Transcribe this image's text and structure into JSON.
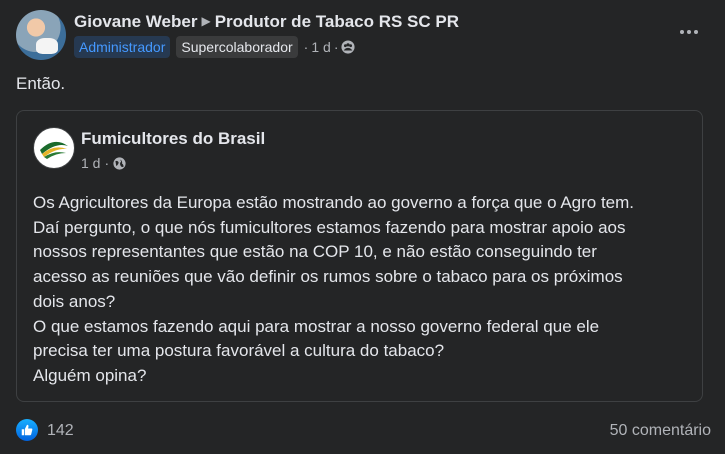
{
  "author": {
    "name": "Giovane Weber",
    "group": "Produtor de Tabaco RS SC PR",
    "badges": [
      "Administrador",
      "Supercolaborador"
    ],
    "time": "1 d",
    "privacy_icon": "group-audience-icon"
  },
  "post": {
    "text": "Então."
  },
  "shared_post": {
    "page_name": "Fumicultores do Brasil",
    "time": "1 d",
    "privacy_icon": "globe-icon",
    "lines": [
      "Os Agricultores da Europa estão mostrando ao governo a força que o Agro tem.",
      "Daí pergunto, o que nós fumicultores estamos fazendo para mostrar apoio aos",
      "nossos representantes que estão na COP 10,  e não estão conseguindo ter",
      "acesso as reuniões que vão definir os rumos sobre o tabaco para os próximos",
      "dois anos?",
      "O que estamos fazendo aqui para mostrar a nosso governo federal que ele",
      "precisa ter uma postura favorável a cultura do tabaco?",
      "Alguém opina?"
    ]
  },
  "footer": {
    "reaction_icon": "like-icon",
    "reaction_count": "142",
    "comments": "50 comentário"
  },
  "colors": {
    "background": "#242526",
    "text": "#e4e6eb",
    "secondary": "#b0b3b8",
    "admin_badge": "#4599ff",
    "like": "#0866ff"
  }
}
